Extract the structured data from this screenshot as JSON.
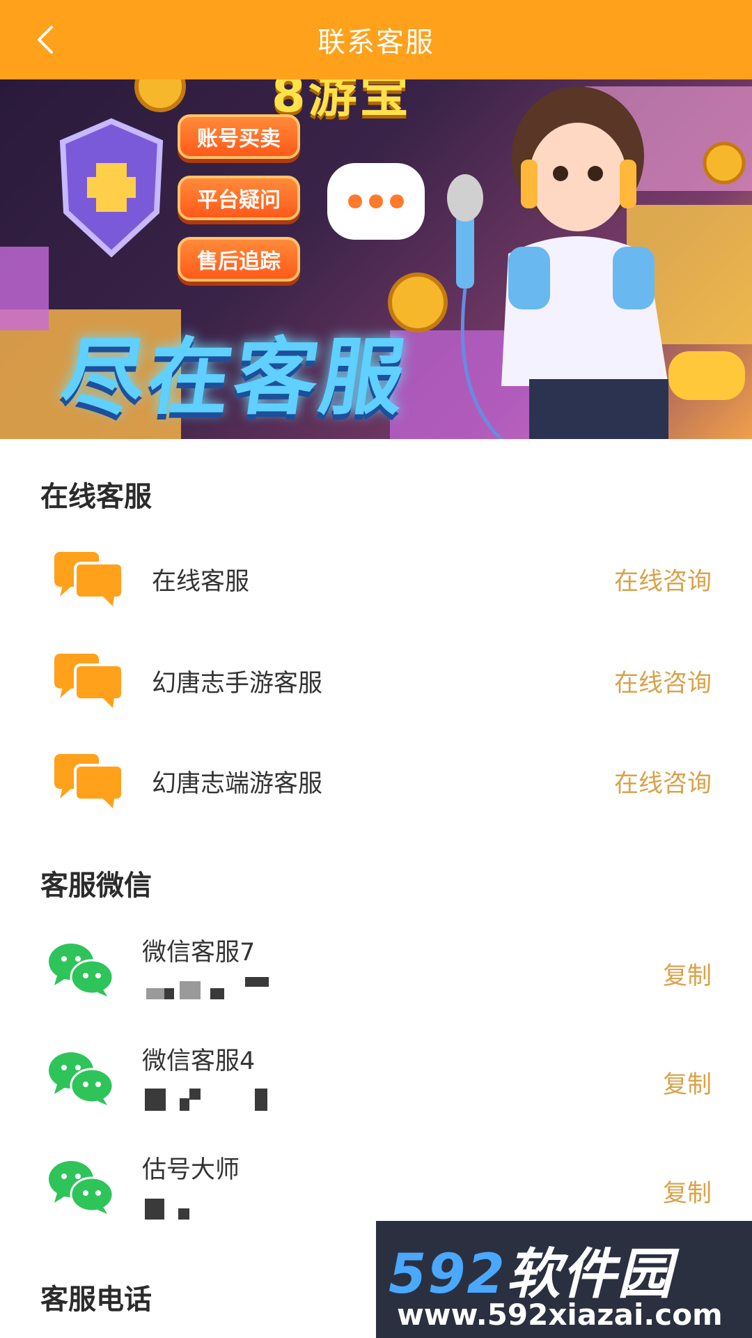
{
  "header": {
    "title": "联系客服"
  },
  "banner": {
    "pills": [
      "账号买卖",
      "平台疑问",
      "售后追踪"
    ],
    "top_text": "8游宝",
    "slogan": "尽在客服"
  },
  "sections": {
    "online": {
      "title": "在线客服",
      "items": [
        {
          "name": "在线客服",
          "action": "在线咨询"
        },
        {
          "name": "幻唐志手游客服",
          "action": "在线咨询"
        },
        {
          "name": "幻唐志端游客服",
          "action": "在线咨询"
        }
      ]
    },
    "wechat": {
      "title": "客服微信",
      "items": [
        {
          "name": "微信客服7",
          "action": "复制"
        },
        {
          "name": "微信客服4",
          "action": "复制"
        },
        {
          "name": "估号大师",
          "action": "复制"
        }
      ]
    },
    "phone": {
      "title": "客服电话"
    }
  },
  "watermark": {
    "brand_num": "592",
    "brand_text": "软件园",
    "url": "www.592xiazai.com"
  },
  "colors": {
    "header": "#ffa11b",
    "action": "#d9a24a",
    "wechat": "#2ec45a",
    "chat": "#ffa11b"
  },
  "icons": {
    "back": "chevron-left-icon",
    "chat": "chat-bubbles-icon",
    "wechat": "wechat-icon"
  }
}
